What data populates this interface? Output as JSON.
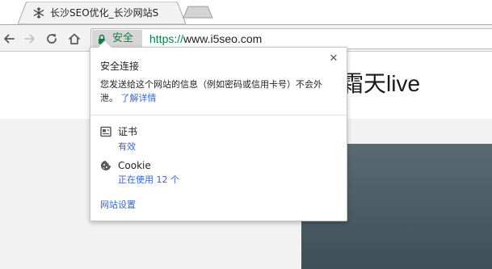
{
  "tab": {
    "title": "长沙SEO优化_长沙网站S",
    "favicon": "snowflake-favicon-icon"
  },
  "toolbar": {
    "back_icon": "back-arrow-icon",
    "forward_icon": "forward-arrow-icon",
    "reload_icon": "reload-icon",
    "home_icon": "home-icon"
  },
  "omnibox": {
    "secure_label": "安全",
    "url_scheme": "https://",
    "url_host": "www.i5seo.com",
    "lock_icon": "lock-icon",
    "secure_color": "#0b8043"
  },
  "page": {
    "logo_text": "霜天live"
  },
  "popup": {
    "title": "安全连接",
    "description": "您发送给这个网站的信息（例如密码或信用卡号）不会外泄。",
    "learn_more": "了解详情",
    "close_icon": "close-icon",
    "certificate": {
      "label": "证书",
      "status": "有效",
      "icon": "certificate-icon"
    },
    "cookie": {
      "label": "Cookie",
      "status": "正在使用 12 个",
      "icon": "cookie-icon"
    },
    "site_settings": "网站设置",
    "link_color": "#3367d6"
  }
}
